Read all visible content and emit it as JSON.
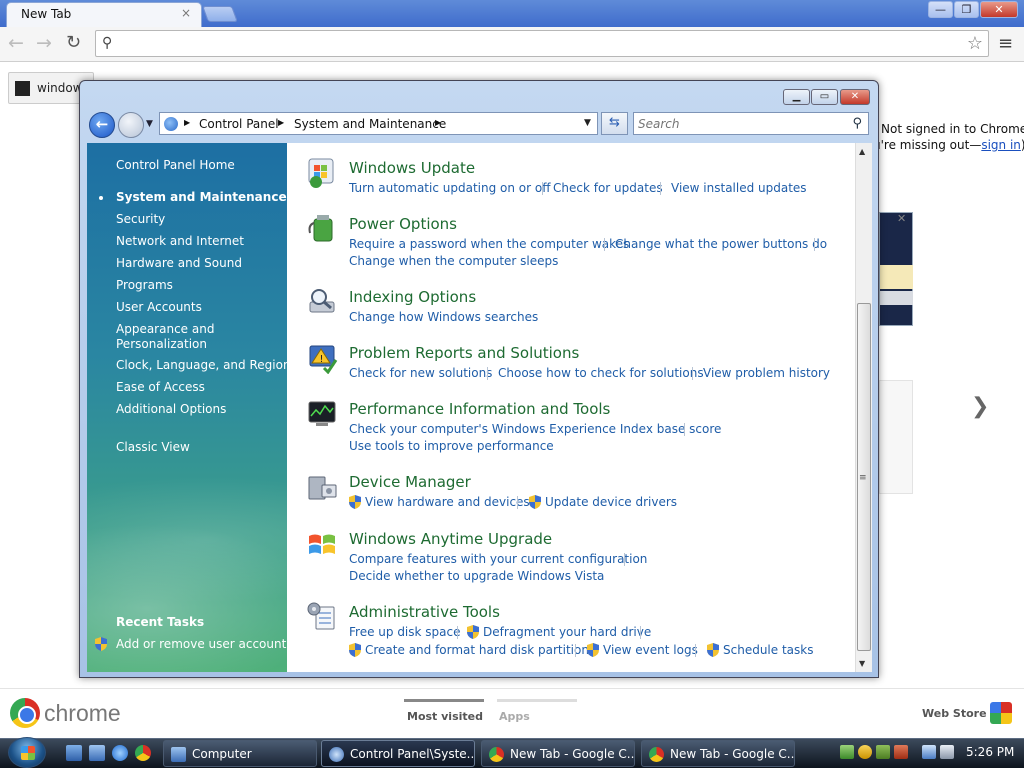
{
  "chrome": {
    "tab_title": "New Tab",
    "tab_close": "×",
    "window_min": "—",
    "window_max": "❐",
    "window_close": "✕",
    "back": "←",
    "forward": "→",
    "reload": "↻",
    "address_value": "",
    "bookmark_app_label": "window",
    "signin_line1": "Not signed in to Chrome",
    "signin_line2_prefix": "u're missing out—",
    "signin_link": "sign in",
    "signin_line2_suffix": ")",
    "next_arrow": "❯",
    "wordmark": "chrome",
    "footer_tabs": [
      "Most visited",
      "Apps"
    ],
    "web_store": "Web Store"
  },
  "control_panel": {
    "breadcrumb": [
      "Control Panel",
      "System and Maintenance"
    ],
    "search_placeholder": "Search",
    "sidebar": {
      "home": "Control Panel Home",
      "current": "System and Maintenance",
      "items": [
        "Security",
        "Network and Internet",
        "Hardware and Sound",
        "Programs",
        "User Accounts",
        "Appearance and",
        "Personalization",
        "Clock, Language, and Region",
        "Ease of Access",
        "Additional Options"
      ],
      "classic_view": "Classic View",
      "recent_tasks_title": "Recent Tasks",
      "recent_task": "Add or remove user accounts"
    },
    "categories": [
      {
        "title": "Windows Update",
        "tasks": [
          "Turn automatic updating on or off",
          "Check for updates",
          "View installed updates"
        ]
      },
      {
        "title": "Power Options",
        "tasks": [
          "Require a password when the computer wakes",
          "Change what the power buttons do",
          "Change when the computer sleeps"
        ]
      },
      {
        "title": "Indexing Options",
        "tasks": [
          "Change how Windows searches"
        ]
      },
      {
        "title": "Problem Reports and Solutions",
        "tasks": [
          "Check for new solutions",
          "Choose how to check for solutions",
          "View problem history"
        ]
      },
      {
        "title": "Performance Information and Tools",
        "tasks": [
          "Check your computer's Windows Experience Index base score",
          "Use tools to improve performance"
        ]
      },
      {
        "title": "Device Manager",
        "tasks": [
          "View hardware and devices",
          "Update device drivers"
        ]
      },
      {
        "title": "Windows Anytime Upgrade",
        "tasks": [
          "Compare features with your current configuration",
          "Decide whether to upgrade Windows Vista"
        ]
      },
      {
        "title": "Administrative Tools",
        "tasks": [
          "Free up disk space",
          "Defragment your hard drive",
          "Create and format hard disk partitions",
          "View event logs",
          "Schedule tasks"
        ]
      }
    ]
  },
  "taskbar": {
    "buttons": [
      "Computer",
      "Control Panel\\Syste...",
      "New Tab - Google C...",
      "New Tab - Google C..."
    ],
    "clock": "5:26 PM"
  },
  "icons": {
    "shield": "uac-shield-icon",
    "search": "search-icon",
    "star": "star-icon"
  },
  "colors": {
    "category_title": "#1e6b32",
    "task_link": "#1f5da8",
    "sidebar_top": "#1d6fa3",
    "sidebar_bottom": "#4fb07a",
    "chrome_frame": "#3f6ccc"
  }
}
